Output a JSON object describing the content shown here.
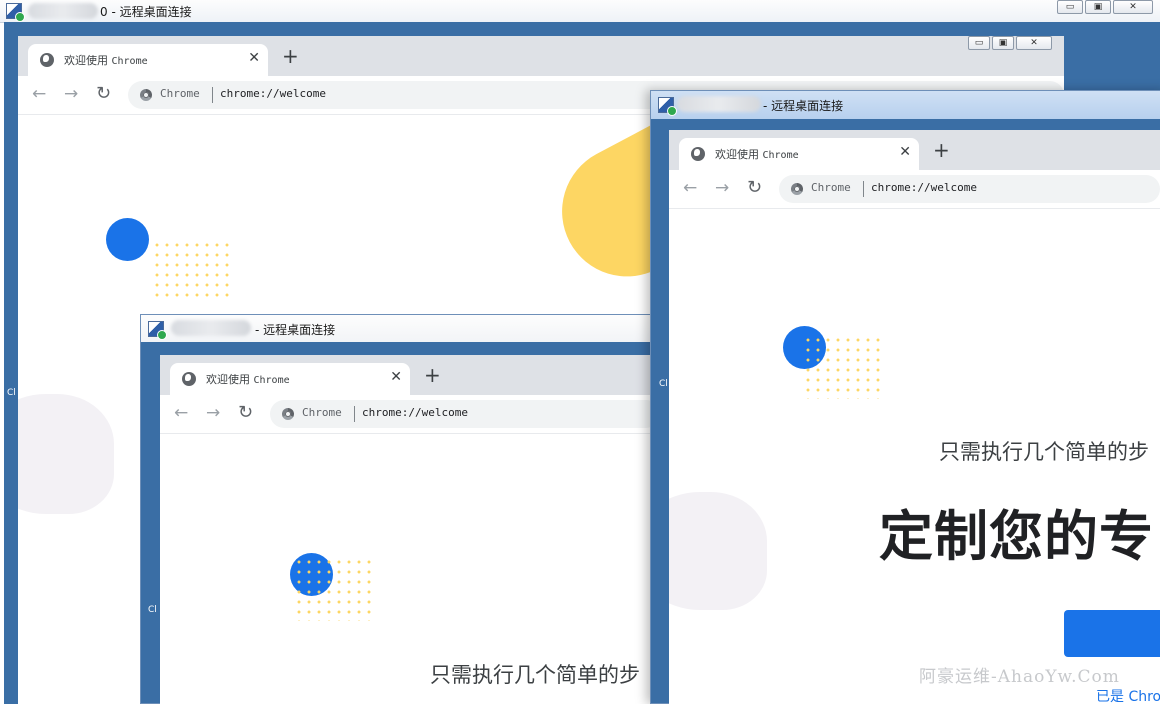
{
  "outer_window": {
    "title_suffix": "0 - 远程桌面连接",
    "controls": {
      "minimize": "▭",
      "restore": "▣",
      "close": "✕"
    }
  },
  "rdp_window_2": {
    "title": "- 远程桌面连接"
  },
  "rdp_window_3": {
    "title": "- 远程桌面连接"
  },
  "chrome": {
    "tab_title_cn": "欢迎使用",
    "tab_title_en": "Chrome",
    "tab_close": "✕",
    "new_tab": "+",
    "back": "←",
    "forward": "→",
    "reload": "↻",
    "omnibox_scheme": "Chrome",
    "omnibox_url": "chrome://welcome",
    "window_controls": {
      "minimize": "▭",
      "restore": "▣",
      "close": "✕"
    }
  },
  "welcome": {
    "subtitle": "只需执行几个简单的步",
    "headline": "定制您的专",
    "signin_link": "已是 Chrome"
  },
  "side_letter": "Cl",
  "watermark": "阿豪运维-AhaoYw.Com",
  "colors": {
    "desktop": "#3a6ea5",
    "chrome_blue": "#1a73e8",
    "accent_yellow": "#fdd663"
  }
}
